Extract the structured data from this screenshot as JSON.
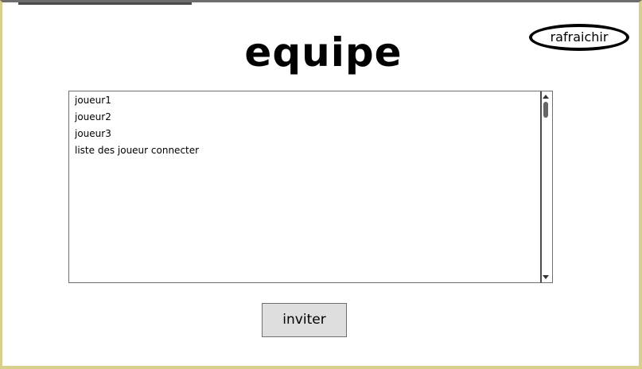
{
  "page": {
    "title": "equipe"
  },
  "toolbar": {
    "refresh_label": "rafraichir"
  },
  "players_list": {
    "items": [
      "joueur1",
      "joueur2",
      "joueur3",
      "liste des joueur connecter"
    ]
  },
  "actions": {
    "invite_label": "inviter"
  },
  "colors": {
    "frame_border": "#d9cf8c",
    "button_bg": "#dedede"
  }
}
